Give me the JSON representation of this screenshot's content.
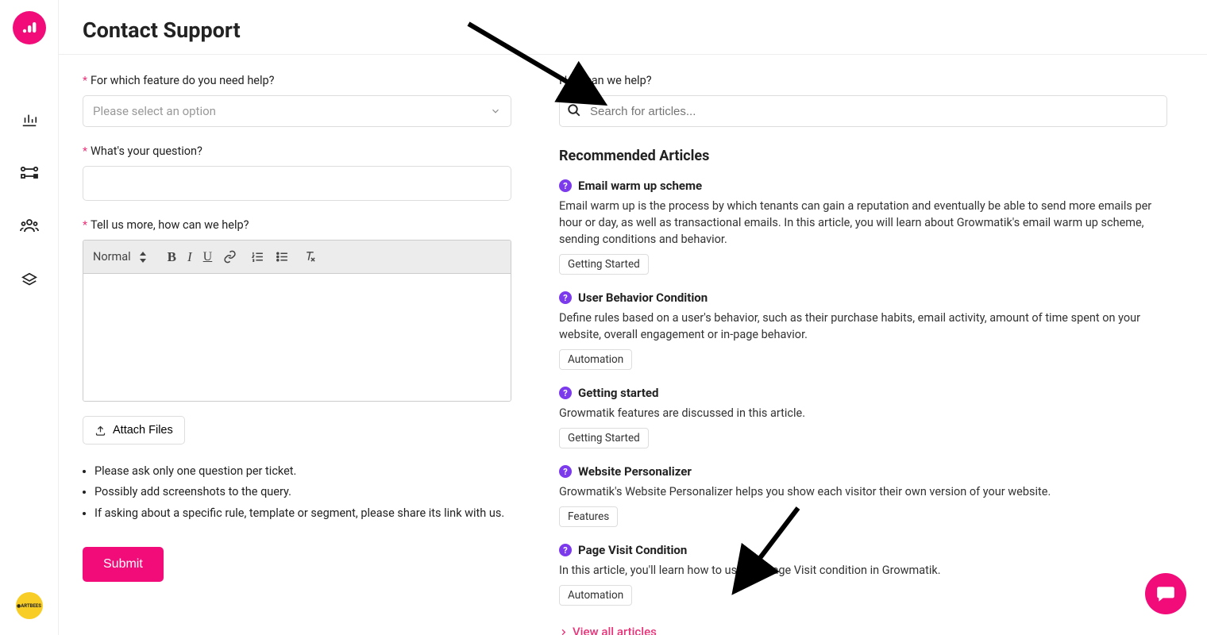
{
  "header": {
    "title": "Contact Support"
  },
  "form": {
    "feature_label": "For which feature do you need help?",
    "feature_placeholder": "Please select an option",
    "question_label": "What's your question?",
    "question_value": "",
    "details_label": "Tell us more, how can we help?",
    "toolbar": {
      "format_label": "Normal"
    },
    "attach_label": "Attach Files",
    "hints": [
      "Please ask only one question per ticket.",
      "Possibly add screenshots to the query.",
      "If asking about a specific rule, template or segment, please share its link with us."
    ],
    "submit_label": "Submit"
  },
  "help": {
    "heading": "How can we help?",
    "search_placeholder": "Search for articles...",
    "recommended_title": "Recommended Articles",
    "articles": [
      {
        "title": "Email warm up scheme",
        "desc": "Email warm up is the process by which tenants can gain a reputation and eventually be able to send more emails per hour or day, as well as transactional emails. In this article, you will learn about Growmatik's email warm up scheme, sending conditions and behavior.",
        "tag": "Getting Started"
      },
      {
        "title": "User Behavior Condition",
        "desc": "Define rules based on a user's behavior, such as their purchase habits, email activity, amount of time spent on your website, overall engagement or in-page behavior.",
        "tag": "Automation"
      },
      {
        "title": "Getting started",
        "desc": "Growmatik features are discussed in this article.",
        "tag": "Getting Started"
      },
      {
        "title": "Website Personalizer",
        "desc": "Growmatik's Website Personalizer helps you show each visitor their own version of your website.",
        "tag": "Features"
      },
      {
        "title": "Page Visit Condition",
        "desc": "In this article, you'll learn how to use the Page Visit condition in Growmatik.",
        "tag": "Automation"
      }
    ],
    "view_all_label": "View all articles"
  },
  "sidebar_badge": "ARTBEES"
}
